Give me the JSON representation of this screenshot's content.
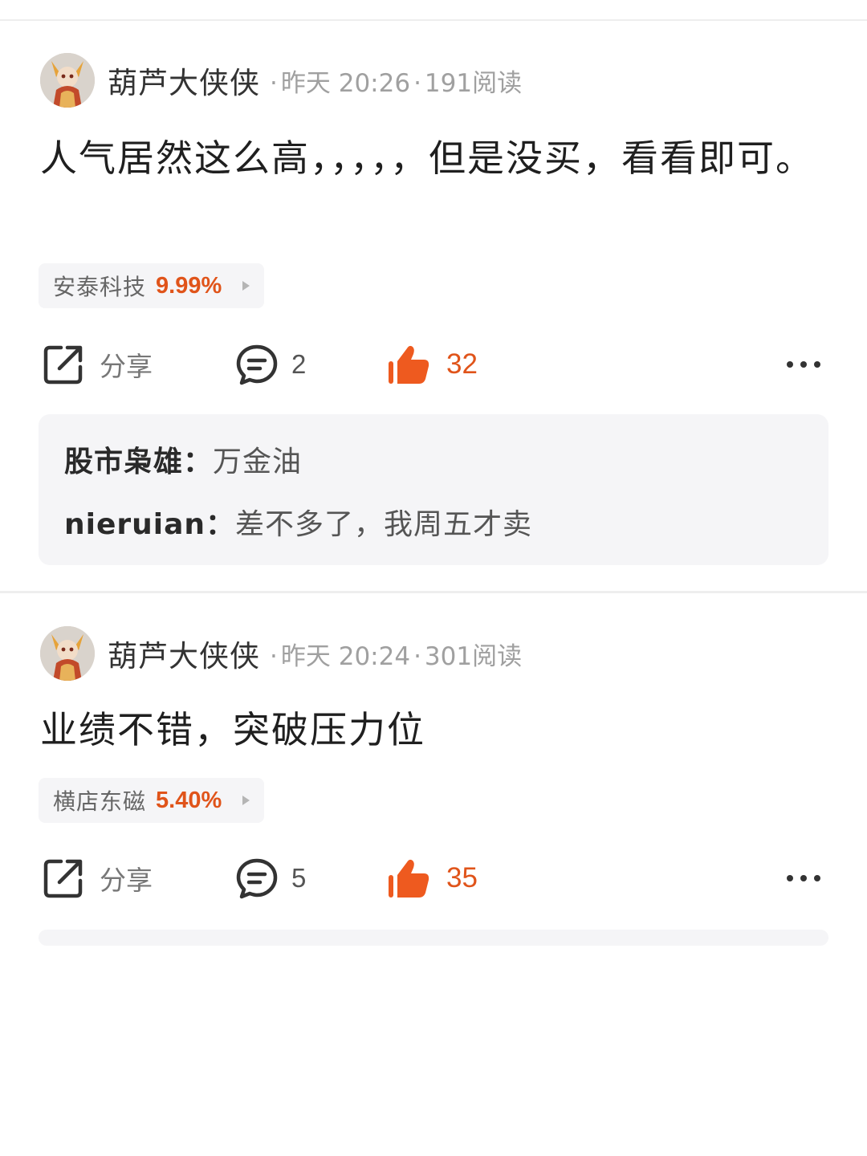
{
  "posts": [
    {
      "author": "葫芦大侠侠",
      "day": "昨天",
      "time": "20:26",
      "reads": "191阅读",
      "content": "人气居然这么高，，，，，但是没买，看看即可。",
      "stock": {
        "name": "安泰科技",
        "change": "9.99%"
      },
      "actions": {
        "share_label": "分享",
        "comments": "2",
        "likes": "32"
      },
      "replies": [
        {
          "user": "股市枭雄",
          "separator": "：",
          "text": "万金油"
        },
        {
          "user": "nieruian",
          "separator": "：",
          "text": "差不多了，我周五才卖"
        }
      ]
    },
    {
      "author": "葫芦大侠侠",
      "day": "昨天",
      "time": "20:24",
      "reads": "301阅读",
      "content": "业绩不错，突破压力位",
      "stock": {
        "name": "横店东磁",
        "change": "5.40%"
      },
      "actions": {
        "share_label": "分享",
        "comments": "5",
        "likes": "35"
      }
    }
  ],
  "colors": {
    "accent": "#e0541a",
    "tag_bg": "#f5f5f7",
    "meta": "#a0a0a0"
  },
  "icons": [
    "share-icon",
    "comment-icon",
    "thumbs-up-icon",
    "more-icon",
    "stock-arrow-icon"
  ]
}
